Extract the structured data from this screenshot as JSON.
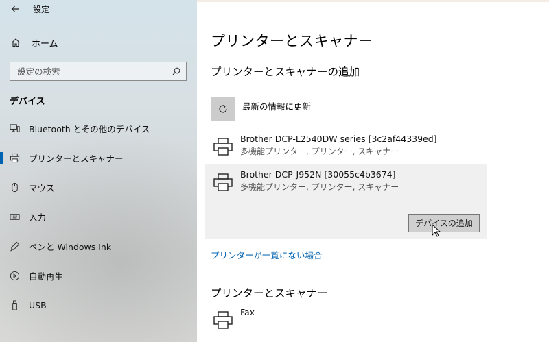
{
  "window": {
    "title": "設定"
  },
  "sidebar": {
    "home_label": "ホーム",
    "search_placeholder": "設定の検索",
    "section_label": "デバイス",
    "items": [
      {
        "label": "Bluetooth とその他のデバイス",
        "icon": "bluetooth-devices-icon"
      },
      {
        "label": "プリンターとスキャナー",
        "icon": "printer-icon",
        "selected": true
      },
      {
        "label": "マウス",
        "icon": "mouse-icon"
      },
      {
        "label": "入力",
        "icon": "keyboard-icon"
      },
      {
        "label": "ペンと Windows Ink",
        "icon": "pen-icon"
      },
      {
        "label": "自動再生",
        "icon": "autoplay-icon"
      },
      {
        "label": "USB",
        "icon": "usb-icon"
      }
    ]
  },
  "main": {
    "title": "プリンターとスキャナー",
    "add_section_title": "プリンターとスキャナーの追加",
    "refresh_label": "最新の情報に更新",
    "found_devices": [
      {
        "name": "Brother DCP-L2540DW series [3c2af44339ed]",
        "type": "多機能プリンター, プリンター, スキャナー"
      },
      {
        "name": "Brother DCP-J952N [30055c4b3674]",
        "type": "多機能プリンター, プリンター, スキャナー",
        "selected": true
      }
    ],
    "add_device_button": "デバイスの追加",
    "not_listed_link": "プリンターが一覧にない場合",
    "installed_section_title": "プリンターとスキャナー",
    "installed": [
      {
        "name": "Fax"
      }
    ]
  },
  "colors": {
    "accent": "#0063b1",
    "selected_row": "#f0f0f0",
    "button_bg": "#cfcfcf"
  }
}
